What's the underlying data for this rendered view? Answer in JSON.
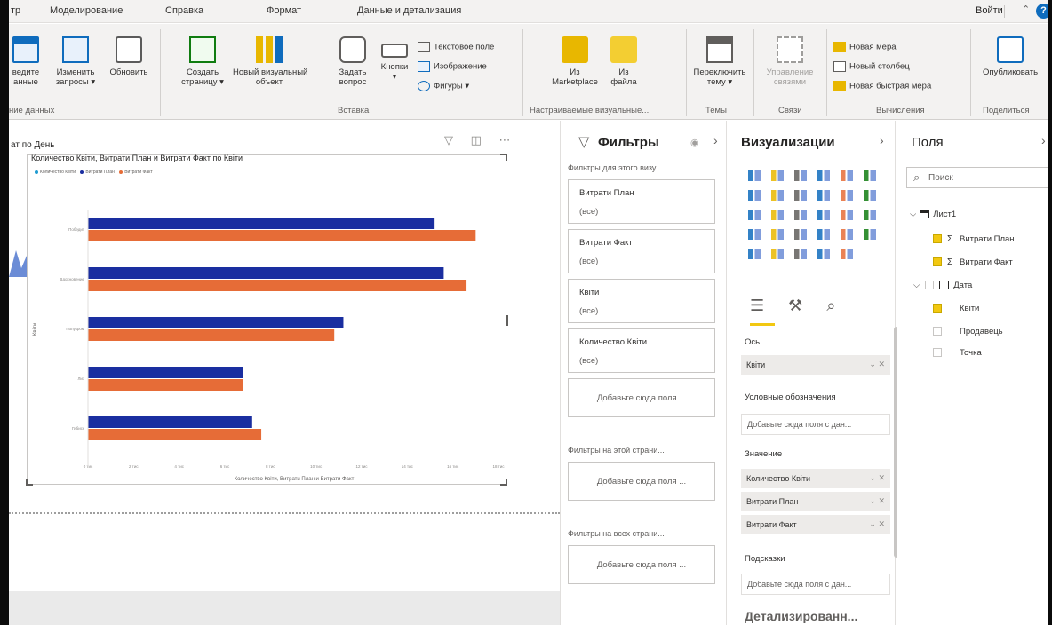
{
  "menu": {
    "items": [
      "тр",
      "Моделирование",
      "Справка",
      "Формат",
      "Данные и детализация"
    ],
    "sign_in": "Войти"
  },
  "ribbon": {
    "enter_data": "ведите\nанные",
    "edit_queries": "Изменить\nзапросы ▾",
    "refresh": "Обновить",
    "new_page": "Создать\nстраницу ▾",
    "new_visual": "Новый визуальный\nобъект",
    "ask_question": "Задать\nвопрос",
    "buttons": "Кнопки\n▾",
    "text_box": "Текстовое поле",
    "image": "Изображение",
    "shapes": "Фигуры ▾",
    "from_marketplace": "Из\nMarketplace",
    "from_file": "Из\nфайла",
    "switch_theme": "Переключить\nтему ▾",
    "manage_relationships": "Управление\nсвязями",
    "new_measure": "Новая мера",
    "new_column": "Новый столбец",
    "new_quick_measure": "Новая быстрая мера",
    "publish": "Опубликовать",
    "groups": {
      "data": "ние данных",
      "insert": "Вставка",
      "custom_visuals": "Настраиваемые визуальные...",
      "themes": "Темы",
      "relationships": "Связи",
      "calculations": "Вычисления",
      "share": "Поделиться"
    }
  },
  "canvas": {
    "title": "ат по День",
    "chart_title": "Количество Квіти, Витрати План и Витрати Факт по Квіти",
    "legend": [
      "Количество Квіти",
      "Витрати План",
      "Витрати Факт"
    ],
    "x_axis_title": "Количество Квіти, Витрати План и Витрати Факт",
    "y_axis_title": "Квіти",
    "header_icons": "▽ ◫ ⋯"
  },
  "chart_data": {
    "type": "bar",
    "orientation": "horizontal",
    "title": "Количество Квіти, Витрати План и Витрати Факт по Квіти",
    "xlabel": "Количество Квіти, Витрати План и Витрати Факт",
    "ylabel": "Квіти",
    "categories": [
      "Победит",
      "Вдохновение",
      "Полукром",
      "Лиз",
      "Гибиск"
    ],
    "series": [
      {
        "name": "Витрати План",
        "color": "#1a2ea0",
        "values": [
          15.2,
          15.6,
          11.2,
          6.8,
          7.2
        ]
      },
      {
        "name": "Витрати Факт",
        "color": "#e66c37",
        "values": [
          17.0,
          16.6,
          10.8,
          6.8,
          7.6
        ]
      }
    ],
    "xlim": [
      0,
      18
    ],
    "x_ticks": [
      "0 тис",
      "2 тис",
      "4 тис",
      "6 тис",
      "8 тис",
      "10 тис",
      "12 тис",
      "14 тис",
      "16 тис",
      "18 тис"
    ],
    "legend_position": "top-left",
    "grid": false
  },
  "filters": {
    "title": "Фильтры",
    "section_visual": "Фильтры для этого визу...",
    "cards": [
      {
        "name": "Витрати План",
        "value": "(все)"
      },
      {
        "name": "Витрати Факт",
        "value": "(все)"
      },
      {
        "name": "Квіти",
        "value": "(все)"
      },
      {
        "name": "Количество Квіти",
        "value": "(все)"
      }
    ],
    "add_here": "Добавьте сюда поля ...",
    "section_page": "Фильтры на этой страни...",
    "section_all": "Фильтры на всех страни..."
  },
  "visualizations": {
    "title": "Визуализации",
    "axis_label": "Ось",
    "axis_field": "Квіти",
    "legend_label": "Условные обозначения",
    "legend_drop": "Добавьте сюда поля с дан...",
    "values_label": "Значение",
    "value_fields": [
      "Количество Квіти",
      "Витрати План",
      "Витрати Факт"
    ],
    "tooltips_label": "Подсказки",
    "tooltips_drop": "Добавьте сюда поля с дан...",
    "drillthrough_label": "Детализированн..."
  },
  "fields": {
    "title": "Поля",
    "search_placeholder": "Поиск",
    "table_name": "Лист1",
    "items": [
      {
        "label": "Витрати План",
        "checked": true,
        "sigma": true
      },
      {
        "label": "Витрати Факт",
        "checked": true,
        "sigma": true
      },
      {
        "label": "Дата",
        "checked": false,
        "sigma": false
      },
      {
        "label": "Квіти",
        "checked": true,
        "sigma": false
      },
      {
        "label": "Продавець",
        "checked": false,
        "sigma": false
      },
      {
        "label": "Точка",
        "checked": false,
        "sigma": false
      }
    ]
  }
}
